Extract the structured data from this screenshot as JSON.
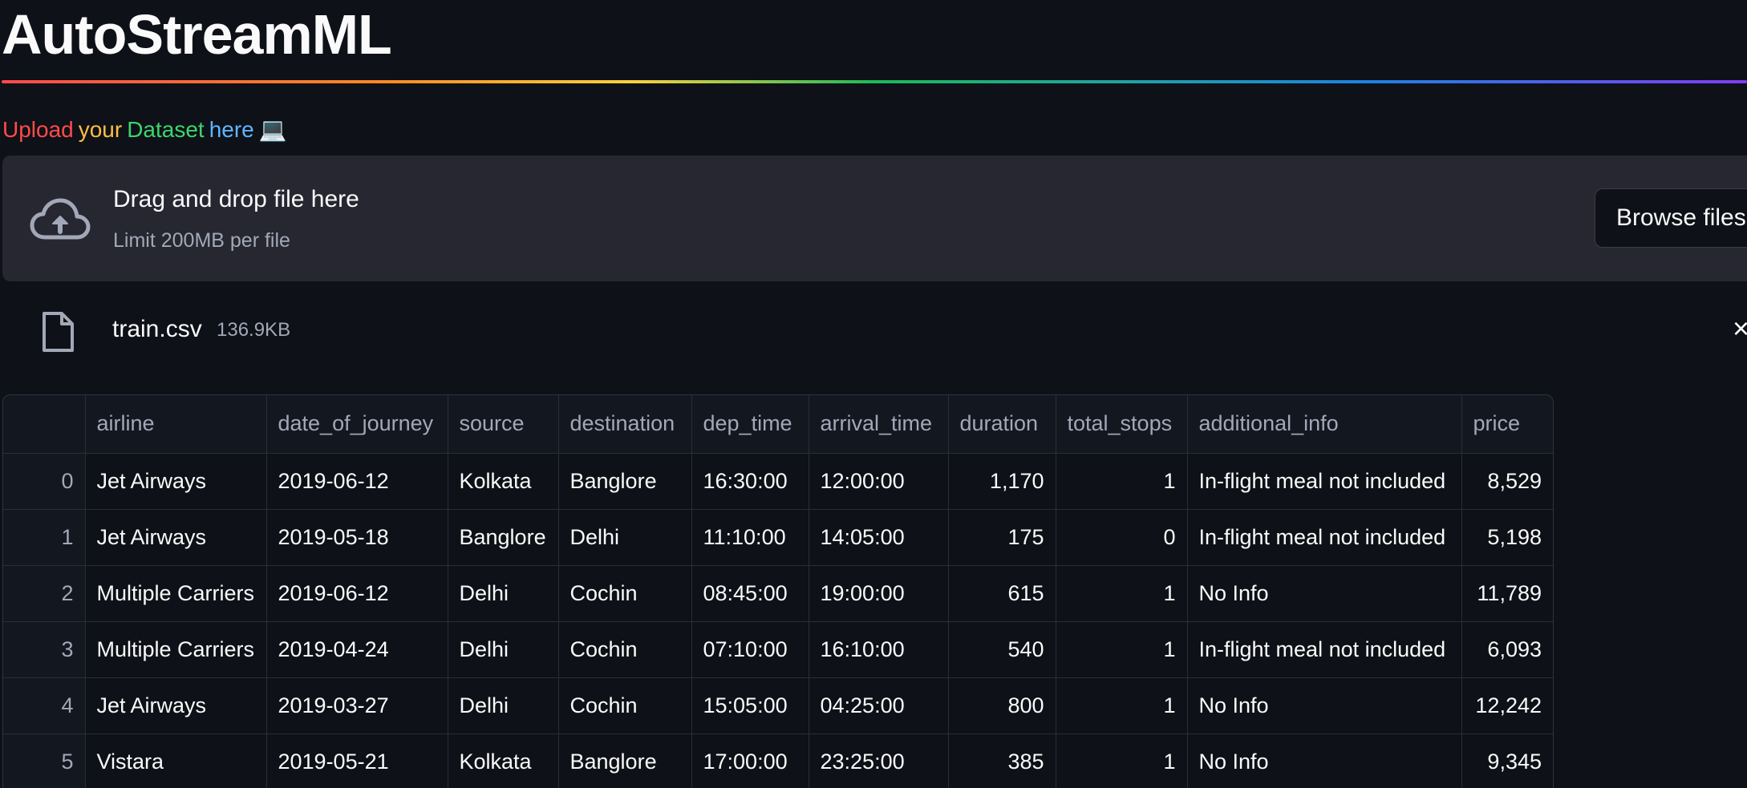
{
  "app": {
    "title": "AutoStreamML"
  },
  "upload": {
    "label_words": [
      "Upload",
      "your",
      "Dataset",
      "here"
    ],
    "label_emoji": "💻",
    "dropzone_title": "Drag and drop file here",
    "dropzone_limit": "Limit 200MB per file",
    "browse_label": "Browse files",
    "icon": "cloud-upload-icon"
  },
  "file": {
    "name": "train.csv",
    "size": "136.9KB",
    "icon": "file-icon",
    "remove_icon": "close-icon",
    "remove_glyph": "×"
  },
  "table": {
    "columns": [
      "",
      "airline",
      "date_of_journey",
      "source",
      "destination",
      "dep_time",
      "arrival_time",
      "duration",
      "total_stops",
      "additional_info",
      "price"
    ],
    "rows": [
      [
        "0",
        "Jet Airways",
        "2019-06-12",
        "Kolkata",
        "Banglore",
        "16:30:00",
        "12:00:00",
        "1,170",
        "1",
        "In-flight meal not included",
        "8,529"
      ],
      [
        "1",
        "Jet Airways",
        "2019-05-18",
        "Banglore",
        "Delhi",
        "11:10:00",
        "14:05:00",
        "175",
        "0",
        "In-flight meal not included",
        "5,198"
      ],
      [
        "2",
        "Multiple Carriers",
        "2019-06-12",
        "Delhi",
        "Cochin",
        "08:45:00",
        "19:00:00",
        "615",
        "1",
        "No Info",
        "11,789"
      ],
      [
        "3",
        "Multiple Carriers",
        "2019-04-24",
        "Delhi",
        "Cochin",
        "07:10:00",
        "16:10:00",
        "540",
        "1",
        "In-flight meal not included",
        "6,093"
      ],
      [
        "4",
        "Jet Airways",
        "2019-03-27",
        "Delhi",
        "Cochin",
        "15:05:00",
        "04:25:00",
        "800",
        "1",
        "No Info",
        "12,242"
      ],
      [
        "5",
        "Vistara",
        "2019-05-21",
        "Kolkata",
        "Banglore",
        "17:00:00",
        "23:25:00",
        "385",
        "1",
        "No Info",
        "9,345"
      ]
    ]
  },
  "colors": {
    "background": "#0e1117",
    "surface": "#262730",
    "text": "#fafafa",
    "muted": "#a3a8b8",
    "word_upload": "#ff4b4b",
    "word_your": "#ffbd45",
    "word_dataset": "#3dd56d",
    "word_here": "#60b4ff"
  }
}
